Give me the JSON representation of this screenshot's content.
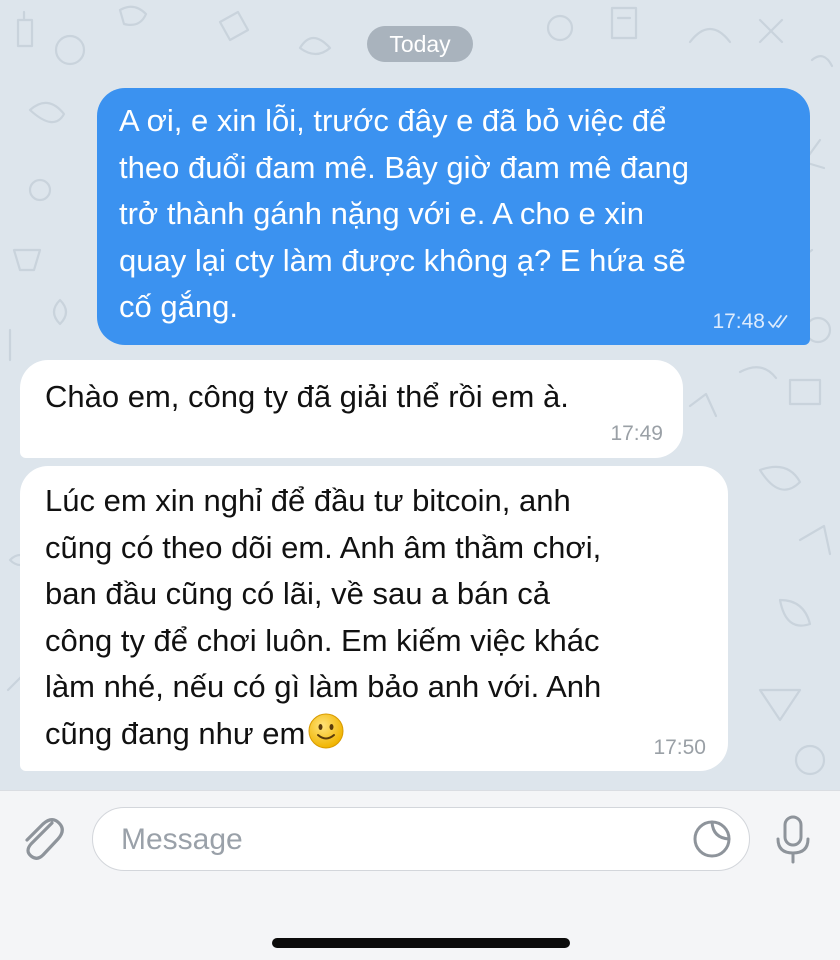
{
  "chat": {
    "date_label": "Today",
    "messages": [
      {
        "direction": "outgoing",
        "text": "A ơi, e xin lỗi, trước đây e đã bỏ việc để\ntheo đuổi đam mê. Bây giờ đam mê đang\ntrở thành gánh nặng với e. A cho e xin\nquay lại cty làm được không ạ? E hứa sẽ\ncố gắng.",
        "time": "17:48",
        "status_icon": "double-check-icon"
      },
      {
        "direction": "incoming",
        "text": "Chào em, công ty đã giải thể rồi em à.",
        "time": "17:49"
      },
      {
        "direction": "incoming",
        "text": "Lúc em xin nghỉ để đầu tư bitcoin, anh\ncũng có theo dõi em. Anh âm thầm chơi,\nban đầu cũng có lãi, về sau a bán cả\ncông ty để chơi luôn. Em kiếm việc khác\nlàm nhé, nếu có gì làm bảo anh với. Anh\ncũng đang như em",
        "emoji_icon": "smiley-face-icon",
        "time": "17:50"
      }
    ]
  },
  "composer": {
    "placeholder": "Message",
    "attach_icon": "paperclip-icon",
    "sticker_icon": "sticker-icon",
    "mic_icon": "microphone-icon"
  },
  "colors": {
    "chat_background": "#dde5ec",
    "outgoing_bubble": "#3b92f0",
    "incoming_bubble": "#ffffff",
    "date_pill": "#a9b3bd",
    "composer_background": "#f4f5f7"
  }
}
